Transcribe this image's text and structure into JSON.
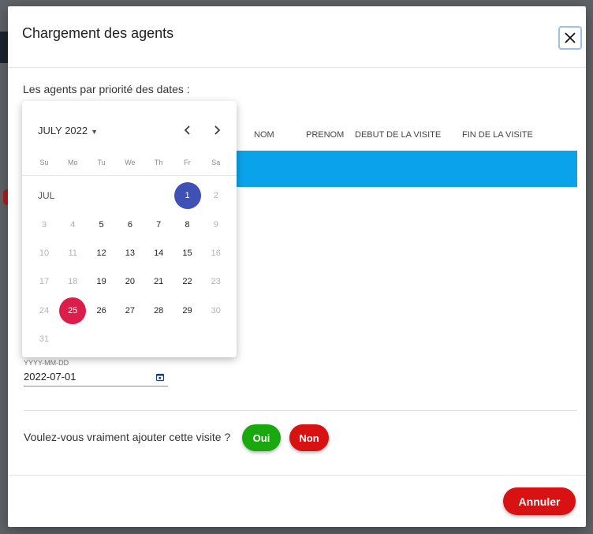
{
  "dialog": {
    "title": "Chargement des agents",
    "subtitle": "Les agents par priorité des dates :",
    "table_headers": [
      "NOM",
      "PRENOM",
      "DEBUT DE LA VISITE",
      "FIN DE LA VISITE"
    ],
    "date_field": {
      "label": "YYYY-MM-DD",
      "value": "2022-07-01"
    },
    "confirm": {
      "question": "Voulez-vous vraiment ajouter cette visite ?",
      "yes": "Oui",
      "no": "Non"
    },
    "cancel_label": "Annuler"
  },
  "calendar": {
    "month_label": "JULY 2022",
    "month_short": "JUL",
    "weekdays": [
      "Su",
      "Mo",
      "Tu",
      "We",
      "Th",
      "Fr",
      "Sa"
    ],
    "weeks": [
      [
        {
          "d": "1",
          "cls": "sel1"
        },
        {
          "d": "2",
          "cls": "dim"
        }
      ],
      [
        {
          "d": "3",
          "cls": "dim"
        },
        {
          "d": "4",
          "cls": "dim"
        },
        {
          "d": "5",
          "cls": ""
        },
        {
          "d": "6",
          "cls": ""
        },
        {
          "d": "7",
          "cls": ""
        },
        {
          "d": "8",
          "cls": ""
        },
        {
          "d": "9",
          "cls": "dim"
        }
      ],
      [
        {
          "d": "10",
          "cls": "dim"
        },
        {
          "d": "11",
          "cls": "dim"
        },
        {
          "d": "12",
          "cls": ""
        },
        {
          "d": "13",
          "cls": ""
        },
        {
          "d": "14",
          "cls": ""
        },
        {
          "d": "15",
          "cls": ""
        },
        {
          "d": "16",
          "cls": "dim"
        }
      ],
      [
        {
          "d": "17",
          "cls": "dim"
        },
        {
          "d": "18",
          "cls": "dim"
        },
        {
          "d": "19",
          "cls": ""
        },
        {
          "d": "20",
          "cls": ""
        },
        {
          "d": "21",
          "cls": ""
        },
        {
          "d": "22",
          "cls": ""
        },
        {
          "d": "23",
          "cls": "dim"
        }
      ],
      [
        {
          "d": "24",
          "cls": "dim"
        },
        {
          "d": "25",
          "cls": "sel2"
        },
        {
          "d": "26",
          "cls": ""
        },
        {
          "d": "27",
          "cls": ""
        },
        {
          "d": "28",
          "cls": ""
        },
        {
          "d": "29",
          "cls": ""
        },
        {
          "d": "30",
          "cls": "dim"
        }
      ],
      [
        {
          "d": "31",
          "cls": "dim"
        }
      ]
    ]
  },
  "colors": {
    "header_row": "#0aa2e8",
    "yes_button": "#1aa80f",
    "no_button": "#d81212",
    "selected_start": "#3f51b5",
    "selected_end": "#dc1c4a"
  }
}
